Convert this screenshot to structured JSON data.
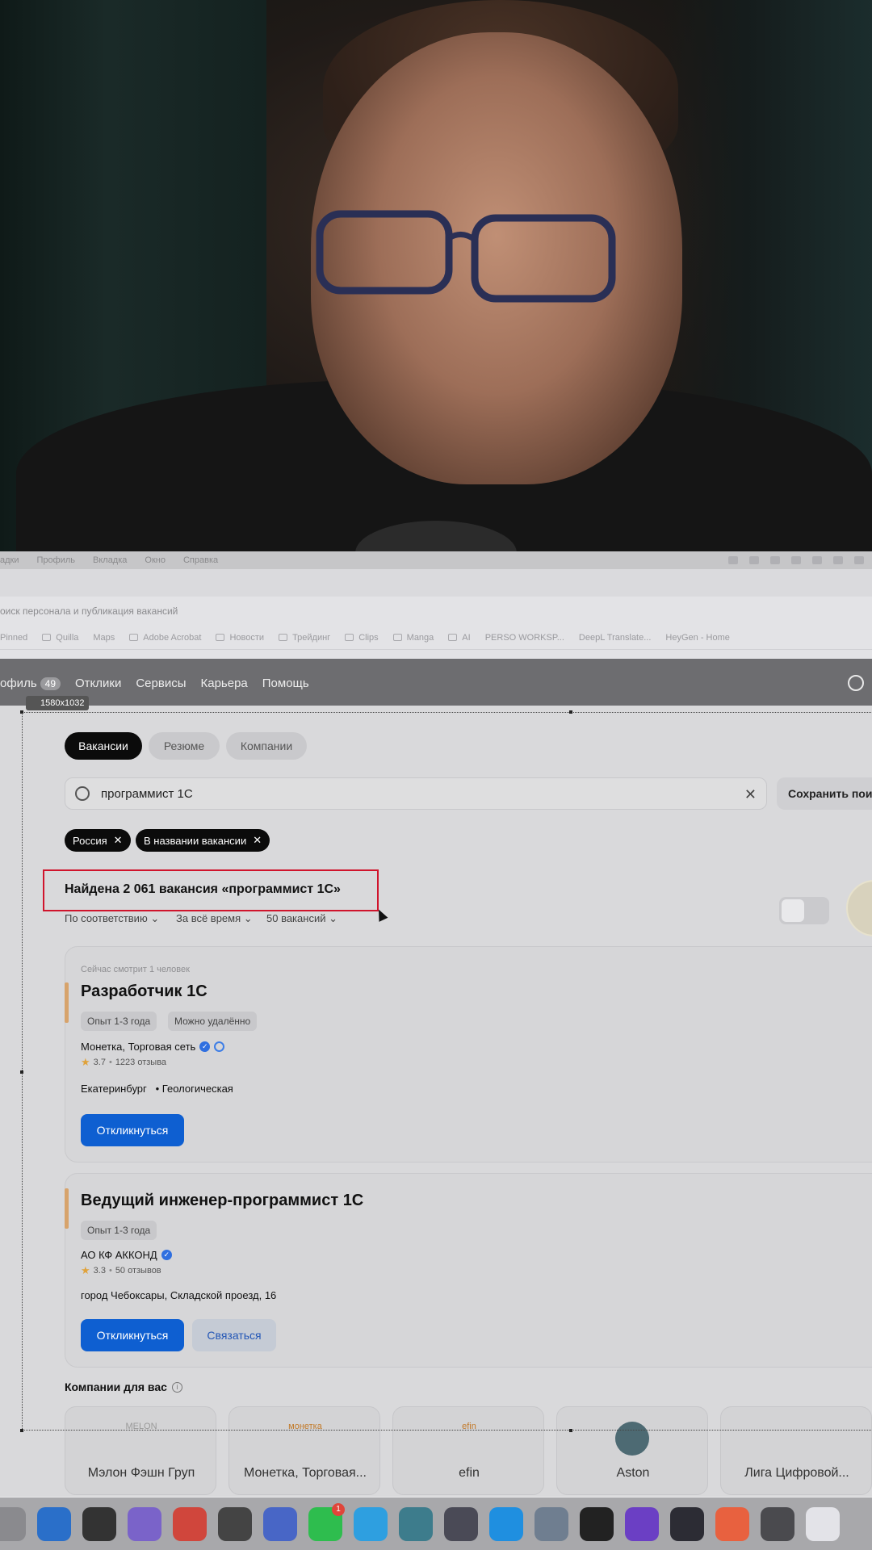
{
  "menubar": {
    "items": [
      "адки",
      "Профиль",
      "Вкладка",
      "Окно",
      "Справка"
    ]
  },
  "browser": {
    "page_title": "оиск персонала и публикация вакансий",
    "bookmarks": [
      "Pinned",
      "Quilla",
      "Maps",
      "Adobe Acrobat",
      "Новости",
      "Трейдинг",
      "Clips",
      "Manga",
      "AI",
      "PERSO WORKSP...",
      "DeepL Translate...",
      "HeyGen - Home"
    ]
  },
  "site_nav": {
    "profile_label": "офиль",
    "profile_badge": "49",
    "items": [
      "Отклики",
      "Сервисы",
      "Карьера",
      "Помощь"
    ]
  },
  "selection_label": "1580x1032",
  "tabs": {
    "vacancies": "Вакансии",
    "resume": "Резюме",
    "companies": "Компании"
  },
  "search": {
    "value": "программист 1С",
    "save_label": "Сохранить пои"
  },
  "filters": [
    "Россия",
    "В названии вакансии"
  ],
  "results": {
    "title": "Найдена 2 061 вакансия «программист 1С»",
    "sort": [
      "По соответствию",
      "За всё время",
      "50 вакансий"
    ]
  },
  "jobs": [
    {
      "viewing": "Сейчас смотрит 1 человек",
      "title": "Разработчик 1С",
      "tags": [
        "Опыт 1-3 года",
        "Можно удалённо"
      ],
      "company": "Монетка, Торговая сеть",
      "rating": "3.7",
      "reviews": "1223 отзыва",
      "location_city": "Екатеринбург",
      "location_metro": "Геологическая",
      "apply_label": "Откликнуться"
    },
    {
      "title": "Ведущий инженер-программист 1С",
      "tags": [
        "Опыт 1-3 года"
      ],
      "company": "АО КФ АККОНД",
      "rating": "3.3",
      "reviews": "50 отзывов",
      "location": "город Чебоксары, Складской проезд, 16",
      "apply_label": "Откликнуться",
      "contact_label": "Связаться"
    }
  ],
  "companies_section": {
    "title": "Компании для вас",
    "items": [
      "Мэлон Фэшн Груп",
      "Монетка, Торговая...",
      "efin",
      "Aston",
      "Лига Цифровой..."
    ],
    "logos": [
      "MELON",
      "монетка",
      "efin",
      "",
      ""
    ]
  },
  "dock": {
    "whatsapp_badge": "1"
  }
}
